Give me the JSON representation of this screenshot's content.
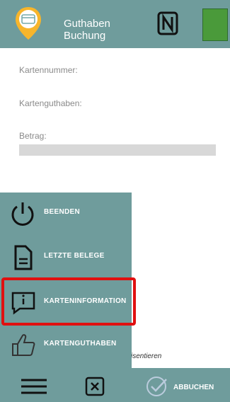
{
  "header": {
    "title_line1": "Guthaben",
    "title_line2": "Buchung",
    "status_color": "#4a9a3a"
  },
  "form": {
    "card_number_label": "Kartennummer:",
    "card_balance_label": "Kartenguthaben:",
    "amount_label": "Betrag:",
    "hidden_text": "isentieren"
  },
  "menu": {
    "items": [
      {
        "label": "BEENDEN",
        "icon": "power-icon"
      },
      {
        "label": "LETZTE BELEGE",
        "icon": "document-icon"
      },
      {
        "label": "KARTENINFORMATION",
        "icon": "info-message-icon"
      },
      {
        "label": "KARTENGUTHABEN",
        "icon": "thumbs-up-icon"
      }
    ]
  },
  "bottom": {
    "cancel_label": "ABBUCHEN"
  },
  "colors": {
    "teal": "#6f9c9c",
    "highlight": "#e01010"
  }
}
